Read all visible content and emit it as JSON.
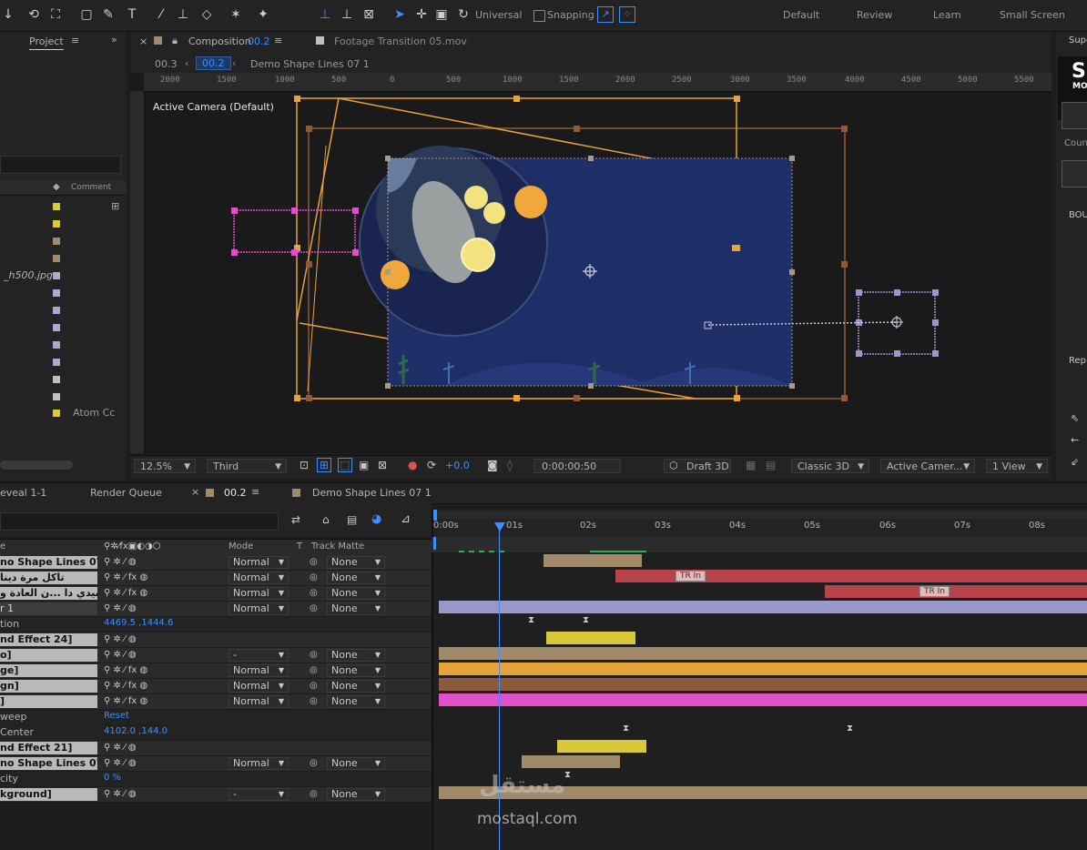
{
  "toolbar": {
    "universal": "Universal",
    "snapping": "Snapping"
  },
  "workspaces": [
    "Default",
    "Review",
    "Learn",
    "Small Screen"
  ],
  "project": {
    "tab": "Project",
    "column_comment": "Comment",
    "partial_filename": "_h500.jpg",
    "partial_comment": "Atom Cc"
  },
  "composition_panel": {
    "tab_label": "Composition",
    "tab_comp": "00.2",
    "footage_tab": "Footage Transition 05.mov",
    "breadcrumb_prev": "00.3",
    "breadcrumb_current": "00.2",
    "breadcrumb_next": "Demo Shape Lines 07 1",
    "camera_label": "Active Camera (Default)"
  },
  "ruler_h": [
    "2000",
    "1500",
    "1000",
    "500",
    "0",
    "500",
    "1000",
    "1500",
    "2000",
    "2500",
    "3000",
    "3500",
    "4000",
    "4500",
    "5000",
    "5500"
  ],
  "viewer_controls": {
    "zoom": "12.5%",
    "resolution": "Third",
    "exposure": "+0.0",
    "timecode": "0:00:00:50",
    "draft3d": "Draft 3D",
    "renderer": "Classic 3D",
    "camera": "Active Camer...",
    "views": "1 View"
  },
  "right_panel": {
    "title_partial": "Supe",
    "big_letter": "S",
    "sub_letters": "MO",
    "count_label": "Coun",
    "bou_label": "BOU",
    "rep_label": "Rep"
  },
  "timeline_tabs": {
    "tab1": "eveal 1-1",
    "tab2": "Render Queue",
    "tab3": "00.2",
    "tab4": "Demo Shape Lines 07 1"
  },
  "timeline_columns": {
    "name_col": "e",
    "mode": "Mode",
    "t": "T",
    "track_matte": "Track Matte"
  },
  "time_ticks": [
    "0:00s",
    "01s",
    "02s",
    "03s",
    "04s",
    "05s",
    "06s",
    "07s",
    "08s"
  ],
  "layers": [
    {
      "name": "no Shape Lines 07 1]",
      "style": "label",
      "mode": "Normal",
      "matte": "None",
      "fx": false
    },
    {
      "name": "تاكل مرة دينا",
      "style": "label",
      "mode": "Normal",
      "matte": "None",
      "fx": true
    },
    {
      "name": "سيدي دا ...ن العادة و",
      "style": "label",
      "mode": "Normal",
      "matte": "None",
      "fx": true
    },
    {
      "name": "r 1",
      "style": "dark",
      "mode": "Normal",
      "matte": "None",
      "fx": false
    },
    {
      "name": "tion",
      "style": "prop",
      "value": "4469.5 ,1444.6"
    },
    {
      "name": "nd Effect 24]",
      "style": "label"
    },
    {
      "name": "o]",
      "style": "label",
      "mode": "-",
      "matte": "None",
      "fx": false
    },
    {
      "name": "ge]",
      "style": "label",
      "mode": "Normal",
      "matte": "None",
      "fx": true
    },
    {
      "name": "gn]",
      "style": "label",
      "mode": "Normal",
      "matte": "None",
      "fx": true
    },
    {
      "name": "]",
      "style": "label",
      "mode": "Normal",
      "matte": "None",
      "fx": true
    },
    {
      "name": "weep",
      "style": "prop",
      "value": "Reset"
    },
    {
      "name": "Center",
      "style": "prop",
      "value": "4102.0 ,144.0"
    },
    {
      "name": "nd Effect 21]",
      "style": "label"
    },
    {
      "name": "no Shape Lines 07 1]",
      "style": "label",
      "mode": "Normal",
      "matte": "None",
      "fx": false
    },
    {
      "name": "city",
      "style": "prop",
      "value": "0 %"
    },
    {
      "name": "kground]",
      "style": "label",
      "mode": "-",
      "matte": "None",
      "fx": false
    }
  ],
  "markers": {
    "tr_in": "TR In"
  },
  "watermark": {
    "arabic": "مستقل",
    "latin": "mostaql.com"
  },
  "colors": {
    "accent": "#3d8fff",
    "orange": "#e8a23a",
    "brown": "#8c5a3c",
    "pink": "#e050c8",
    "tan": "#a08a6a",
    "red": "#b8434a",
    "lavender": "#9a98c8",
    "yellow": "#d8c83a",
    "comp_bg": "#1e2e66"
  }
}
